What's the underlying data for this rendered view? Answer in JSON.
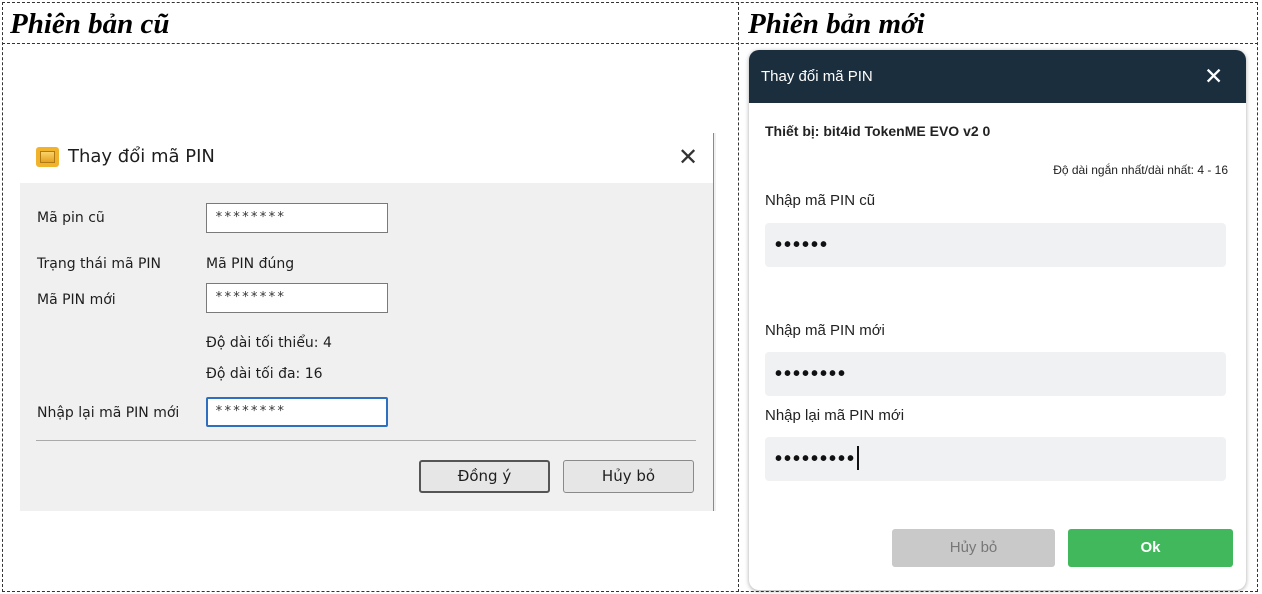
{
  "headers": {
    "old": "Phiên bản cũ",
    "new": "Phiên bản mới"
  },
  "old_dialog": {
    "title": "Thay đổi mã PIN",
    "close_glyph": "✕",
    "fields": {
      "old_pin_label": "Mã pin cũ",
      "old_pin_value": "********",
      "pin_status_label": "Trạng thái mã PIN",
      "pin_status_value": "Mã PIN đúng",
      "new_pin_label": "Mã PIN mới",
      "new_pin_value": "********",
      "min_length": "Độ dài tối thiểu: 4",
      "max_length": "Độ dài tối đa: 16",
      "confirm_pin_label": "Nhập lại mã PIN mới",
      "confirm_pin_value": "********"
    },
    "buttons": {
      "ok": "Đồng ý",
      "cancel": "Hủy bỏ"
    }
  },
  "new_dialog": {
    "title": "Thay đổi mã PIN",
    "close_glyph": "✕",
    "device": "Thiết bị: bit4id TokenME EVO v2 0",
    "length_hint": "Độ dài ngắn nhất/dài nhất: 4 - 16",
    "old_pin_label": "Nhập mã PIN cũ",
    "old_pin_value": "••••••",
    "new_pin_label": "Nhập mã PIN mới",
    "new_pin_value": "••••••••",
    "confirm_pin_label": "Nhập lại mã PIN mới",
    "confirm_pin_value": "•••••••••",
    "buttons": {
      "cancel": "Hủy bỏ",
      "ok": "Ok"
    }
  },
  "colors": {
    "new_header_bg": "#1a2e3e",
    "ok_green": "#41b85c",
    "cancel_gray": "#c9c9c9",
    "old_focus_blue": "#2f6fc0"
  },
  "icons": {
    "old_app_icon": "smart-card-icon",
    "close": "close-icon"
  }
}
